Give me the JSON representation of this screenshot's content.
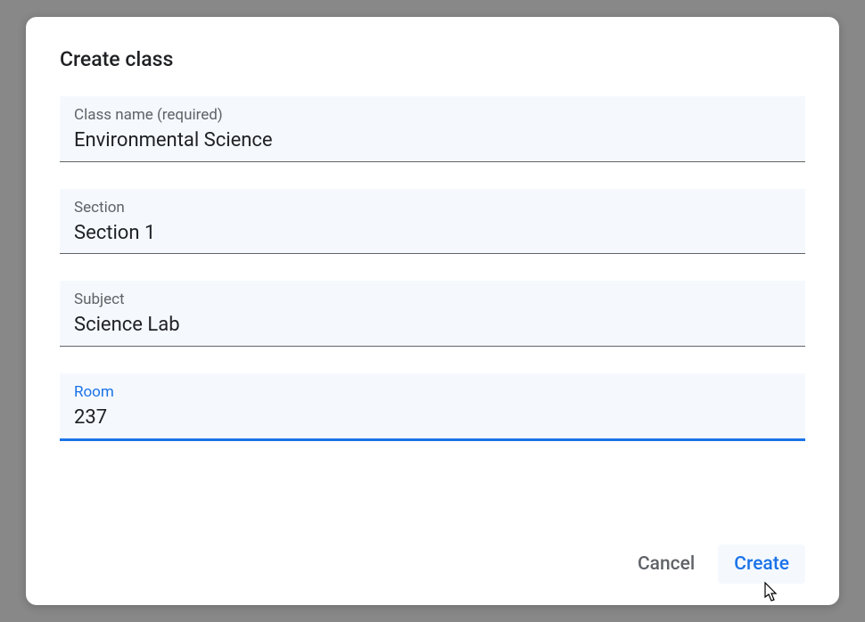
{
  "dialog": {
    "title": "Create class",
    "fields": {
      "class_name": {
        "label": "Class name (required)",
        "value": "Environmental Science"
      },
      "section": {
        "label": "Section",
        "value": "Section 1"
      },
      "subject": {
        "label": "Subject",
        "value": "Science Lab"
      },
      "room": {
        "label": "Room",
        "value": "237"
      }
    },
    "actions": {
      "cancel": "Cancel",
      "create": "Create"
    }
  }
}
